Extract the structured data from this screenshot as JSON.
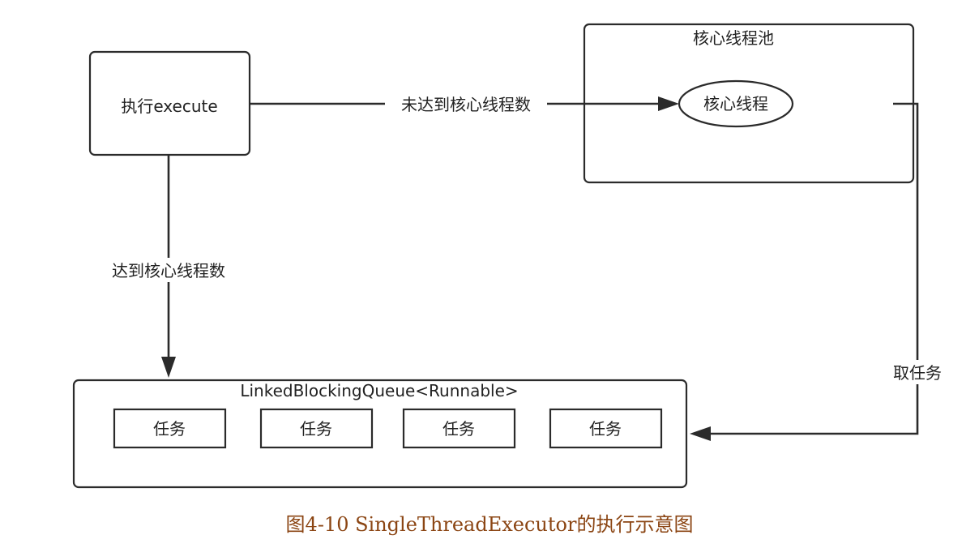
{
  "diagram": {
    "execute_box": "执行execute",
    "pool_title": "核心线程池",
    "core_thread": "核心线程",
    "edge_not_reached": "未达到核心线程数",
    "edge_reached": "达到核心线程数",
    "edge_take_task": "取任务",
    "queue_title": "LinkedBlockingQueue<Runnable>",
    "tasks": [
      "任务",
      "任务",
      "任务",
      "任务"
    ]
  },
  "caption": "图4-10 SingleThreadExecutor的执行示意图",
  "colors": {
    "caption": "#8b4513",
    "stroke": "#2b2b2b"
  }
}
